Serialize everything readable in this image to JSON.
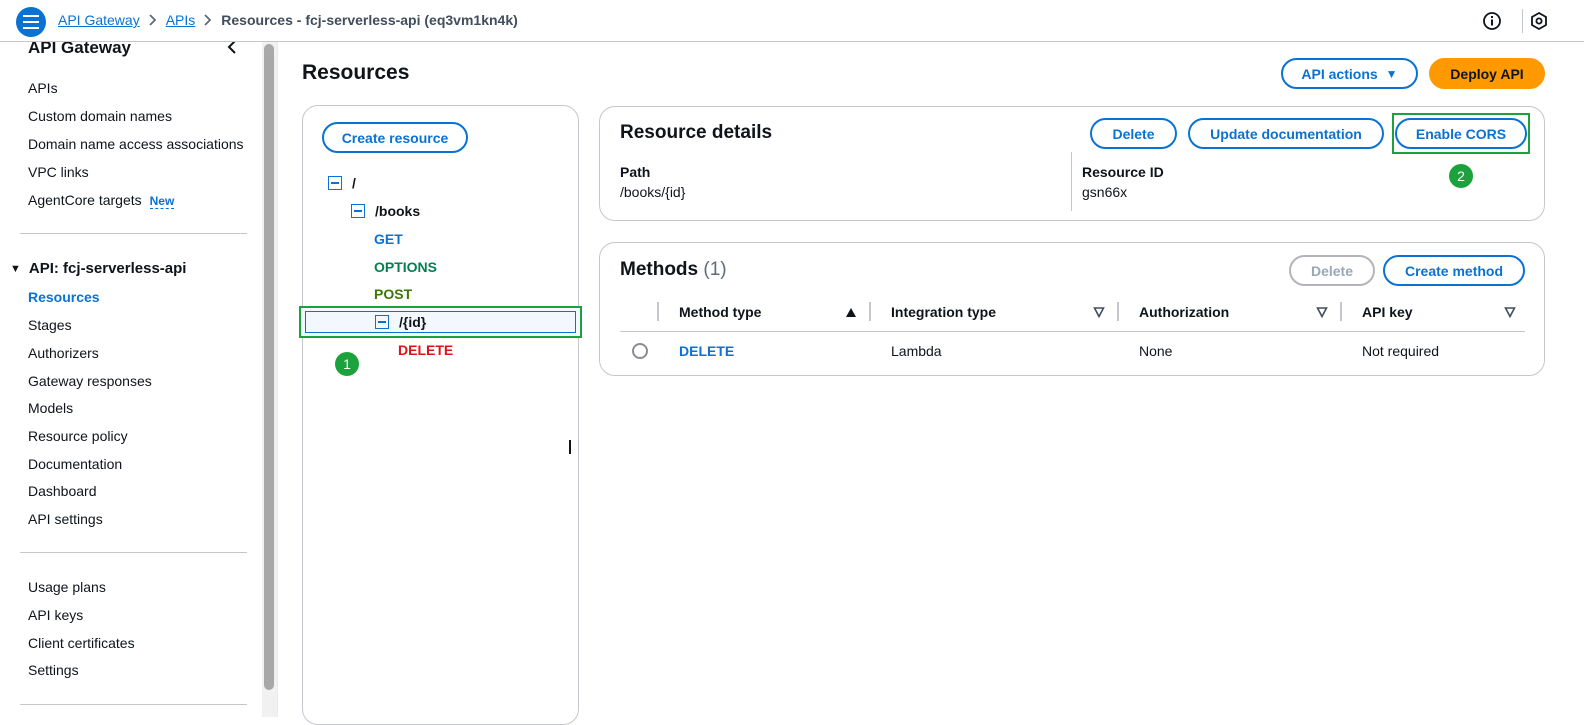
{
  "breadcrumbs": [
    {
      "label": "API Gateway"
    },
    {
      "label": "APIs"
    },
    {
      "label": "Resources - fcj-serverless-api (eq3vm1kn4k)"
    }
  ],
  "sidebar": {
    "title": "API Gateway",
    "top_items": [
      {
        "label": "APIs"
      },
      {
        "label": "Custom domain names"
      },
      {
        "label": "Domain name access associations"
      },
      {
        "label": "VPC links"
      },
      {
        "label": "AgentCore targets",
        "badge": "New"
      }
    ],
    "api_section": {
      "label": "API: fcj-serverless-api",
      "items": [
        {
          "label": "Resources",
          "active": true
        },
        {
          "label": "Stages"
        },
        {
          "label": "Authorizers"
        },
        {
          "label": "Gateway responses"
        },
        {
          "label": "Models"
        },
        {
          "label": "Resource policy"
        },
        {
          "label": "Documentation"
        },
        {
          "label": "Dashboard"
        },
        {
          "label": "API settings"
        }
      ]
    },
    "bottom_items": [
      {
        "label": "Usage plans"
      },
      {
        "label": "API keys"
      },
      {
        "label": "Client certificates"
      },
      {
        "label": "Settings"
      }
    ]
  },
  "main": {
    "title": "Resources",
    "api_actions_label": "API actions",
    "deploy_label": "Deploy API",
    "create_resource_label": "Create resource",
    "tree": {
      "root": "/",
      "books": "/books",
      "books_methods": [
        "GET",
        "OPTIONS",
        "POST"
      ],
      "id": "/{id}",
      "id_methods": [
        "DELETE"
      ]
    },
    "step_badges": [
      "1",
      "2"
    ],
    "resource_details": {
      "title": "Resource details",
      "delete_label": "Delete",
      "update_doc_label": "Update documentation",
      "enable_cors_label": "Enable CORS",
      "path_label": "Path",
      "path_value": "/books/{id}",
      "resource_id_label": "Resource ID",
      "resource_id_value": "gsn66x"
    },
    "methods": {
      "title": "Methods",
      "count": "(1)",
      "delete_label": "Delete",
      "create_label": "Create method",
      "columns": [
        "Method type",
        "Integration type",
        "Authorization",
        "API key"
      ],
      "rows": [
        {
          "method": "DELETE",
          "integration": "Lambda",
          "authorization": "None",
          "api_key": "Not required"
        }
      ]
    }
  },
  "colors": {
    "accent": "#0972d3",
    "deploy": "#ff9900",
    "highlight": "#1ba23c",
    "get": "#0972d3",
    "options": "#037f51",
    "post": "#3b7a02",
    "delete": "#d91515"
  }
}
